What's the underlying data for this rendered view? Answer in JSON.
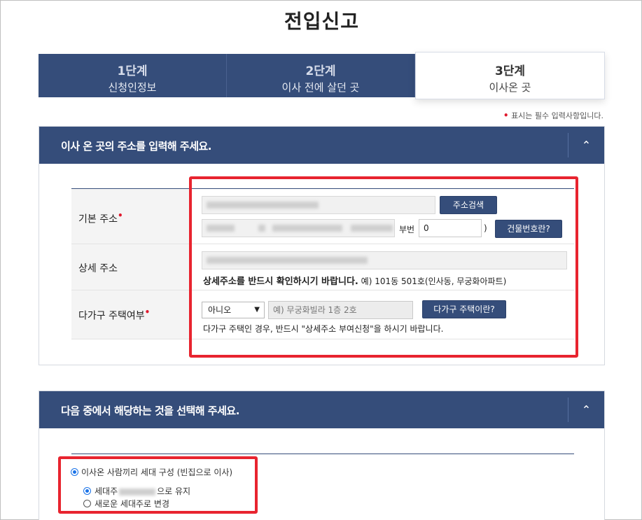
{
  "page": {
    "title": "전입신고"
  },
  "steps": [
    {
      "num": "1단계",
      "label": "신청인정보"
    },
    {
      "num": "2단계",
      "label": "이사 전에 살던 곳"
    },
    {
      "num": "3단계",
      "label": "이사온 곳"
    }
  ],
  "required_note": "표시는 필수 입력사항입니다.",
  "section1": {
    "title": "이사 온 곳의 주소를 입력해 주세요.",
    "toggle_icon": "chevron-up-icon",
    "rows": {
      "basic_address": {
        "label": "기본 주소",
        "search_button": "주소검색",
        "bunji_label": "부번",
        "bunji_value": "0",
        "close_paren": ")",
        "building_button": "건물번호란?"
      },
      "detail_address": {
        "label": "상세 주소",
        "notice_bold": "상세주소를 반드시 확인하시기 바랍니다.",
        "notice_example": "예) 101동 501호(인사동, 무궁화아파트)"
      },
      "multi_house": {
        "label": "다가구 주택여부",
        "select_value": "아니오",
        "input_placeholder": "예) 무궁화빌라 1층 2호",
        "info_button": "다가구 주택이란?",
        "notice": "다가구 주택인 경우, 반드시 \"상세주소 부여신청\"을 하시기 바랍니다."
      }
    }
  },
  "section2": {
    "title": "다음 중에서 해당하는 것을 선택해 주세요.",
    "toggle_icon": "chevron-up-icon",
    "options": {
      "main": "이사온 사람끼리 세대 구성 (빈집으로 이사)",
      "sub1_prefix": "세대주",
      "sub1_suffix": "으로 유지",
      "sub2": "새로운 세대주로 변경"
    }
  },
  "colors": {
    "navy": "#354d7a",
    "red_highlight": "#e8242f",
    "required_dot": "#e0192d"
  }
}
